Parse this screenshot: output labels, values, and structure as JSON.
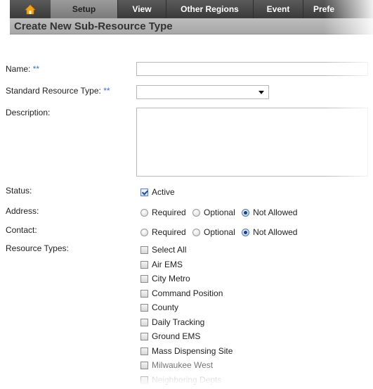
{
  "nav": {
    "tabs": [
      {
        "label": "Setup"
      },
      {
        "label": "View"
      },
      {
        "label": "Other Regions"
      },
      {
        "label": "Event"
      },
      {
        "label": "Prefe"
      }
    ]
  },
  "page": {
    "title": "Create New Sub-Resource Type"
  },
  "form": {
    "name_label": "Name:",
    "std_type_label": "Standard Resource Type:",
    "required_marker": "**",
    "description_label": "Description:",
    "status_label": "Status:",
    "status_option": "Active",
    "address_label": "Address:",
    "contact_label": "Contact:",
    "radio_options": [
      "Required",
      "Optional",
      "Not Allowed"
    ],
    "resource_types_label": "Resource Types:",
    "resource_types": [
      "Select All",
      "Air EMS",
      "City Metro",
      "Command Position",
      "County",
      "Daily Tracking",
      "Ground EMS",
      "Mass Dispensing Site",
      "Milwaukee West",
      "Neighboring Depts"
    ]
  }
}
